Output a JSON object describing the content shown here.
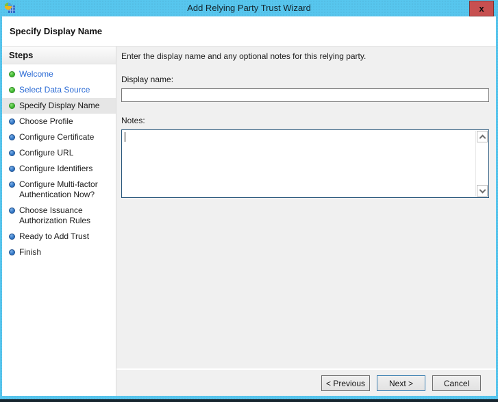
{
  "window": {
    "title": "Add Relying Party Trust Wizard",
    "close_label": "x"
  },
  "header": {
    "title": "Specify Display Name"
  },
  "sidebar": {
    "header": "Steps",
    "steps": [
      {
        "label": "Welcome",
        "state": "done",
        "link": true
      },
      {
        "label": "Select Data Source",
        "state": "done",
        "link": true
      },
      {
        "label": "Specify Display Name",
        "state": "current",
        "link": false
      },
      {
        "label": "Choose Profile",
        "state": "upcoming",
        "link": false
      },
      {
        "label": "Configure Certificate",
        "state": "upcoming",
        "link": false
      },
      {
        "label": "Configure URL",
        "state": "upcoming",
        "link": false
      },
      {
        "label": "Configure Identifiers",
        "state": "upcoming",
        "link": false
      },
      {
        "label": "Configure Multi-factor Authentication Now?",
        "state": "upcoming",
        "link": false
      },
      {
        "label": "Choose Issuance Authorization Rules",
        "state": "upcoming",
        "link": false
      },
      {
        "label": "Ready to Add Trust",
        "state": "upcoming",
        "link": false
      },
      {
        "label": "Finish",
        "state": "upcoming",
        "link": false
      }
    ]
  },
  "main": {
    "instruction": "Enter the display name and any optional notes for this relying party.",
    "display_name": {
      "label": "Display name:",
      "value": ""
    },
    "notes": {
      "label": "Notes:",
      "value": ""
    }
  },
  "footer": {
    "previous_label": "< Previous",
    "next_label": "Next >",
    "cancel_label": "Cancel"
  },
  "colors": {
    "titlebar": "#57c6ee",
    "close_button": "#c75050",
    "link_blue": "#2a6ad4",
    "done_bullet_green": "#3cb52e",
    "upcoming_bullet_blue": "#2e74c4",
    "current_step_highlight": "#e6e6e6",
    "focused_border": "#29587c",
    "panel_gray": "#f0f0f0",
    "default_button_border": "#3c7fb1"
  }
}
